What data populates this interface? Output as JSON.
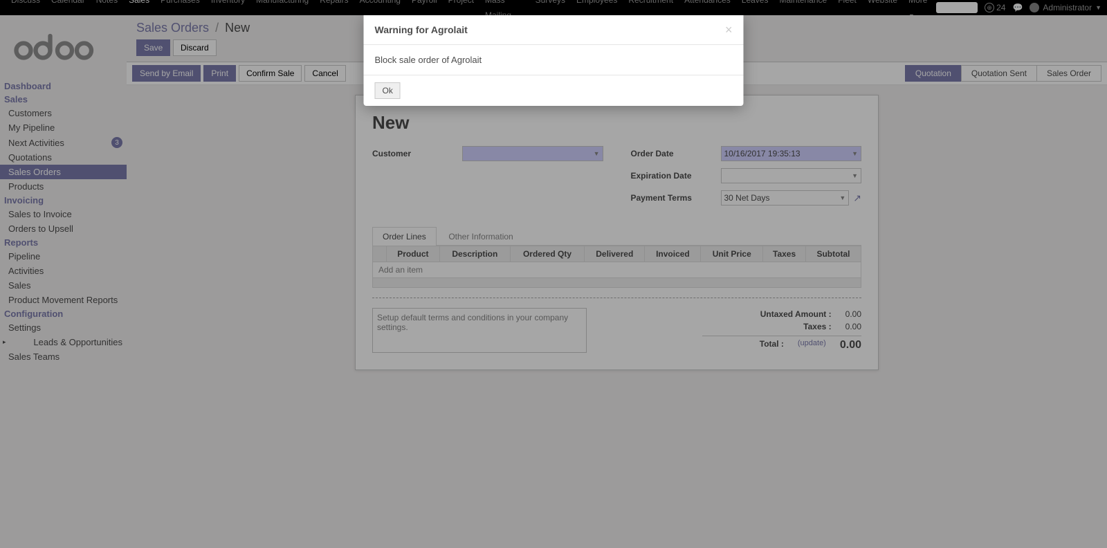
{
  "topnav": {
    "items": [
      "Discuss",
      "Calendar",
      "Notes",
      "Sales",
      "Purchases",
      "Inventory",
      "Manufacturing",
      "Repairs",
      "Accounting",
      "Payroll",
      "Project",
      "Mass Mailing",
      "Surveys",
      "Employees",
      "Recruitment",
      "Attendances",
      "Leaves",
      "Maintenance",
      "Fleet",
      "Website",
      "More"
    ],
    "active_index": 3,
    "notif_count": "24",
    "admin_label": "Administrator"
  },
  "sidebar": {
    "sections": [
      {
        "title": "Dashboard",
        "items": []
      },
      {
        "title": "Sales",
        "items": [
          {
            "label": "Customers"
          },
          {
            "label": "My Pipeline"
          },
          {
            "label": "Next Activities",
            "badge": "3"
          },
          {
            "label": "Quotations"
          },
          {
            "label": "Sales Orders",
            "active": true
          },
          {
            "label": "Products"
          }
        ]
      },
      {
        "title": "Invoicing",
        "items": [
          {
            "label": "Sales to Invoice"
          },
          {
            "label": "Orders to Upsell"
          }
        ]
      },
      {
        "title": "Reports",
        "items": [
          {
            "label": "Pipeline"
          },
          {
            "label": "Activities"
          },
          {
            "label": "Sales"
          },
          {
            "label": "Product Movement Reports"
          }
        ]
      },
      {
        "title": "Configuration",
        "items": [
          {
            "label": "Settings"
          },
          {
            "label": "Leads & Opportunities",
            "caret": true
          },
          {
            "label": "Sales Teams"
          }
        ]
      }
    ]
  },
  "breadcrumb": {
    "parent": "Sales Orders",
    "current": "New"
  },
  "buttons": {
    "save": "Save",
    "discard": "Discard"
  },
  "statusbar": {
    "actions": [
      "Send by Email",
      "Print",
      "Confirm Sale",
      "Cancel"
    ],
    "stages": [
      "Quotation",
      "Quotation Sent",
      "Sales Order"
    ],
    "active_stage": 0
  },
  "form": {
    "title": "New",
    "customer_label": "Customer",
    "order_date_label": "Order Date",
    "order_date_value": "10/16/2017 19:35:13",
    "expiration_label": "Expiration Date",
    "payment_terms_label": "Payment Terms",
    "payment_terms_value": "30 Net Days",
    "tabs": [
      "Order Lines",
      "Other Information"
    ],
    "columns": [
      "Product",
      "Description",
      "Ordered Qty",
      "Delivered",
      "Invoiced",
      "Unit Price",
      "Taxes",
      "Subtotal"
    ],
    "add_item": "Add an item",
    "terms_placeholder": "Setup default terms and conditions in your company settings.",
    "totals": {
      "untaxed_label": "Untaxed Amount :",
      "untaxed_value": "0.00",
      "taxes_label": "Taxes :",
      "taxes_value": "0.00",
      "total_label": "Total :",
      "update": "(update)",
      "total_value": "0.00"
    }
  },
  "modal": {
    "title": "Warning for Agrolait",
    "body": "Block sale order of Agrolait",
    "ok": "Ok"
  }
}
